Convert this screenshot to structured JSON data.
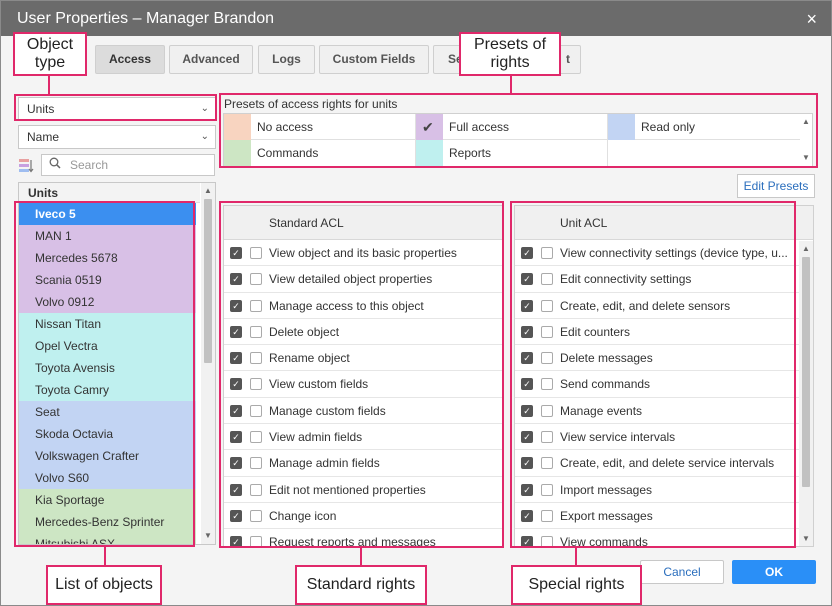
{
  "window": {
    "title": "User Properties – Manager Brandon",
    "close_symbol": "×"
  },
  "tabs": [
    {
      "label": "Access"
    },
    {
      "label": "Advanced"
    },
    {
      "label": "Logs"
    },
    {
      "label": "Custom Fields"
    },
    {
      "label": "Se"
    },
    {
      "label": "t"
    }
  ],
  "left": {
    "type_select": "Units",
    "sort_select": "Name",
    "search_placeholder": "Search",
    "list_header": "Units",
    "units": [
      {
        "name": "Iveco 5",
        "color": "#3b8ff0",
        "selected": true
      },
      {
        "name": "MAN 1",
        "color": "#d8c0e6"
      },
      {
        "name": "Mercedes 5678",
        "color": "#d8c0e6"
      },
      {
        "name": "Scania 0519",
        "color": "#d8c0e6"
      },
      {
        "name": "Volvo 0912",
        "color": "#d8c0e6"
      },
      {
        "name": "Nissan Titan",
        "color": "#bff0ef"
      },
      {
        "name": "Opel Vectra",
        "color": "#bff0ef"
      },
      {
        "name": "Toyota Avensis",
        "color": "#bff0ef"
      },
      {
        "name": "Toyota Camry",
        "color": "#bff0ef"
      },
      {
        "name": "Seat",
        "color": "#c2d4f3"
      },
      {
        "name": "Skoda Octavia",
        "color": "#c2d4f3"
      },
      {
        "name": "Volkswagen Crafter",
        "color": "#c2d4f3"
      },
      {
        "name": "Volvo S60",
        "color": "#c2d4f3"
      },
      {
        "name": "Kia Sportage",
        "color": "#cde6c4"
      },
      {
        "name": "Mercedes-Benz Sprinter",
        "color": "#cde6c4"
      },
      {
        "name": "Mitsubishi ASX",
        "color": "#cde6c4"
      }
    ]
  },
  "presets": {
    "title": "Presets of access rights for units",
    "items": [
      {
        "label": "No access",
        "color": "#f8d4c0"
      },
      {
        "label": "Full access",
        "color": "#d8c0e6",
        "checked": true
      },
      {
        "label": "Read only",
        "color": "#c2d4f3"
      },
      {
        "label": "Commands",
        "color": "#cde6c4"
      },
      {
        "label": "Reports",
        "color": "#bff0ef"
      }
    ],
    "edit_button": "Edit Presets",
    "check_symbol": "✔"
  },
  "standard_acl": {
    "header": "Standard ACL",
    "rows": [
      "View object and its basic properties",
      "View detailed object properties",
      "Manage access to this object",
      "Delete object",
      "Rename object",
      "View custom fields",
      "Manage custom fields",
      "View admin fields",
      "Manage admin fields",
      "Edit not mentioned properties",
      "Change icon",
      "Request reports and messages"
    ]
  },
  "unit_acl": {
    "header": "Unit ACL",
    "rows": [
      "View connectivity settings (device type, u...",
      "Edit connectivity settings",
      "Create, edit, and delete sensors",
      "Edit counters",
      "Delete messages",
      "Send commands",
      "Manage events",
      "View service intervals",
      "Create, edit, and delete service intervals",
      "Import messages",
      "Export messages",
      "View commands"
    ]
  },
  "buttons": {
    "cancel": "Cancel",
    "ok": "OK"
  },
  "callouts": {
    "object_type": "Object type",
    "presets_of_rights": "Presets of rights",
    "list_of_objects": "List of objects",
    "standard_rights": "Standard rights",
    "special_rights": "Special rights"
  },
  "colors": {
    "annotation": "#e0286a",
    "accent": "#3b8ff0",
    "titlebar": "#6b6b6b"
  }
}
